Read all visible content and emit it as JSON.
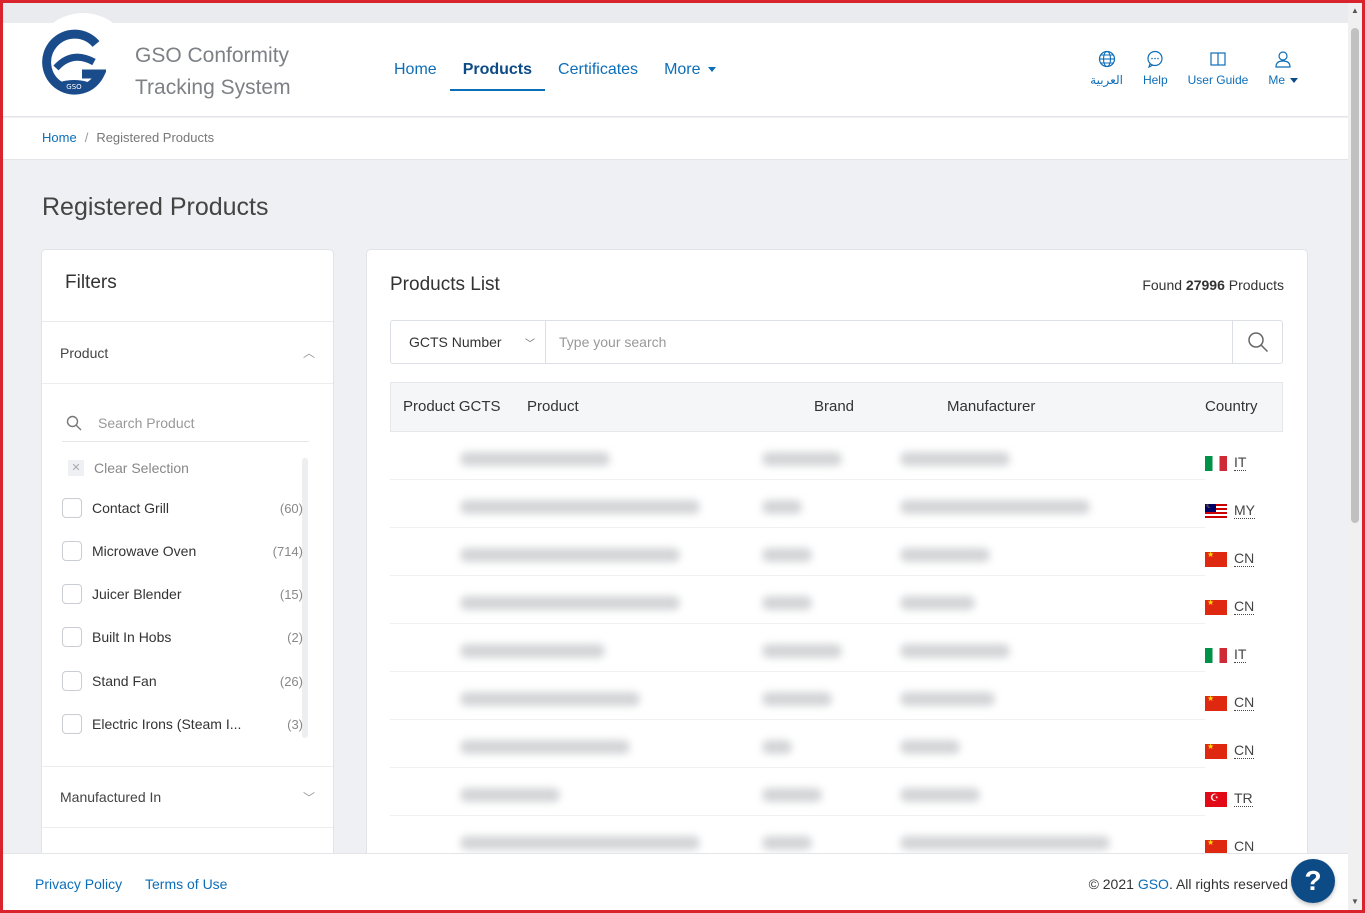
{
  "brand": {
    "line1": "GSO Conformity",
    "line2": "Tracking System",
    "logo_text": "GSO"
  },
  "nav": {
    "home": "Home",
    "products": "Products",
    "certificates": "Certificates",
    "more": "More"
  },
  "tools": {
    "language": "العربية",
    "help": "Help",
    "user_guide": "User Guide",
    "me": "Me"
  },
  "breadcrumb": {
    "home": "Home",
    "current": "Registered Products"
  },
  "page_title": "Registered Products",
  "filters": {
    "title": "Filters",
    "product_facet": {
      "label": "Product",
      "search_placeholder": "Search Product",
      "clear_label": "Clear Selection",
      "options": [
        {
          "label": "Contact Grill",
          "count": "(60)"
        },
        {
          "label": "Microwave Oven",
          "count": "(714)"
        },
        {
          "label": "Juicer Blender",
          "count": "(15)"
        },
        {
          "label": "Built In Hobs",
          "count": "(2)"
        },
        {
          "label": "Stand Fan",
          "count": "(26)"
        },
        {
          "label": "Electric Irons (Steam I...",
          "count": "(3)"
        }
      ]
    },
    "manufactured_in": {
      "label": "Manufactured In"
    }
  },
  "products": {
    "title": "Products List",
    "found_prefix": "Found",
    "found_count": "27996",
    "found_suffix": "Products",
    "search_field": "GCTS Number",
    "search_placeholder": "Type your search",
    "columns": {
      "gcts": "Product GCTS",
      "product": "Product",
      "brand": "Brand",
      "manufacturer": "Manufacturer",
      "country": "Country"
    },
    "rows": [
      {
        "country": "IT",
        "flag": "it"
      },
      {
        "country": "MY",
        "flag": "my"
      },
      {
        "country": "CN",
        "flag": "cn"
      },
      {
        "country": "CN",
        "flag": "cn"
      },
      {
        "country": "IT",
        "flag": "it"
      },
      {
        "country": "CN",
        "flag": "cn"
      },
      {
        "country": "CN",
        "flag": "cn"
      },
      {
        "country": "TR",
        "flag": "tr"
      },
      {
        "country": "CN",
        "flag": "cn"
      }
    ]
  },
  "footer": {
    "privacy": "Privacy Policy",
    "terms": "Terms of Use",
    "copyright_prefix": "© 2021",
    "copyright_org": "GSO",
    "copyright_suffix": ". All rights reserved"
  },
  "help_fab": "?",
  "colors": {
    "accent": "#0d6eb8",
    "brand_dark": "#0d4b86",
    "frame": "#d9232d"
  }
}
